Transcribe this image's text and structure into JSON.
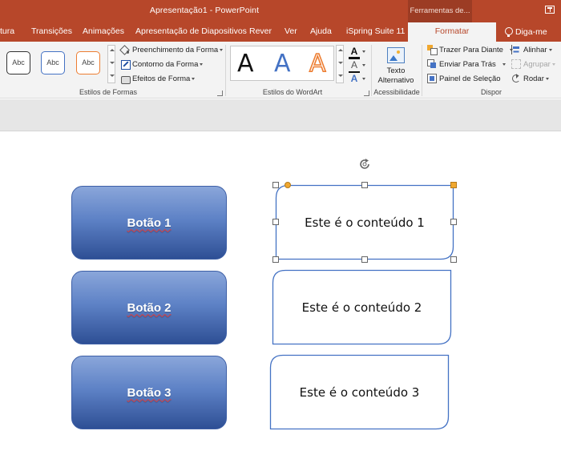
{
  "window": {
    "title": "Apresentação1  -  PowerPoint",
    "contextual_group": "Ferramentas de..."
  },
  "tabs": [
    {
      "label": "tura"
    },
    {
      "label": "Transições"
    },
    {
      "label": "Animações"
    },
    {
      "label": "Apresentação de Diapositivos"
    },
    {
      "label": "Rever"
    },
    {
      "label": "Ver"
    },
    {
      "label": "Ajuda"
    },
    {
      "label": "iSpring Suite 11"
    },
    {
      "label": "Formatar"
    },
    {
      "label": "Diga-me"
    }
  ],
  "ribbon": {
    "shape_styles": {
      "gallery": [
        "Abc",
        "Abc",
        "Abc"
      ],
      "fill": "Preenchimento da Forma",
      "outline": "Contorno da Forma",
      "effects": "Efeitos de Forma",
      "label": "Estilos de Formas"
    },
    "wordart": {
      "gallery": [
        "A",
        "A",
        "A"
      ],
      "text_fill_glyph": "A",
      "text_outline_glyph": "A",
      "text_effects_glyph": "A",
      "label": "Estilos do WordArt"
    },
    "accessibility": {
      "alt_text_line1": "Texto",
      "alt_text_line2": "Alternativo",
      "label": "Acessibilidade"
    },
    "arrange": {
      "bring_forward": "Trazer Para Diante",
      "send_backward": "Enviar Para Trás",
      "selection_pane": "Painel de Seleção",
      "align": "Alinhar",
      "group": "Agrupar",
      "rotate": "Rodar",
      "label": "Dispor"
    }
  },
  "slide": {
    "buttons": [
      {
        "label": "Botão 1"
      },
      {
        "label": "Botão 2"
      },
      {
        "label": "Botão 3"
      }
    ],
    "contents": [
      {
        "label": "Este é o conteúdo 1",
        "selected": true
      },
      {
        "label": "Este é o conteúdo 2",
        "selected": false
      },
      {
        "label": "Este é o conteúdo 3",
        "selected": false
      }
    ]
  },
  "colors": {
    "accent": "#b7472a",
    "shape_blue": "#4472c4",
    "wordart_orange": "#ed7d31"
  }
}
